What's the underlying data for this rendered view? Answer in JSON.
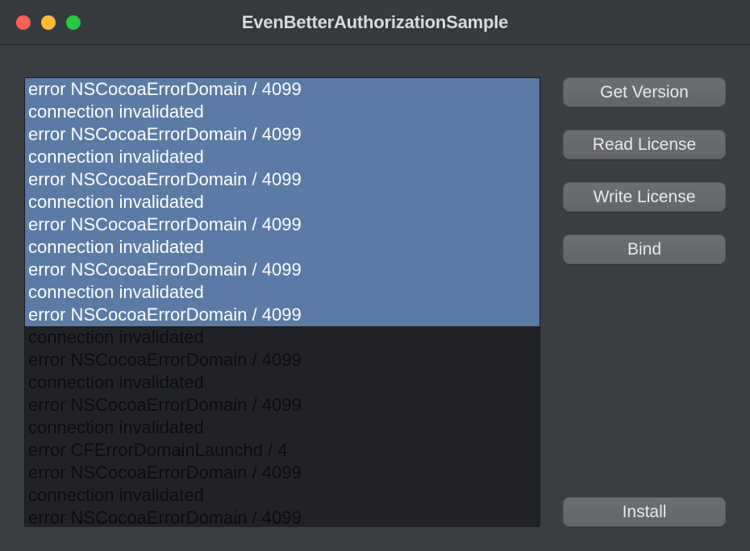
{
  "window": {
    "title": "EvenBetterAuthorizationSample"
  },
  "buttons": {
    "get_version": "Get Version",
    "read_license": "Read License",
    "write_license": "Write License",
    "bind": "Bind",
    "install": "Install"
  },
  "log": {
    "lines": [
      {
        "text": "error NSCocoaErrorDomain / 4099",
        "selected": true
      },
      {
        "text": "connection invalidated",
        "selected": true
      },
      {
        "text": "error NSCocoaErrorDomain / 4099",
        "selected": true
      },
      {
        "text": "connection invalidated",
        "selected": true
      },
      {
        "text": "error NSCocoaErrorDomain / 4099",
        "selected": true
      },
      {
        "text": "connection invalidated",
        "selected": true
      },
      {
        "text": "error NSCocoaErrorDomain / 4099",
        "selected": true
      },
      {
        "text": "connection invalidated",
        "selected": true
      },
      {
        "text": "error NSCocoaErrorDomain / 4099",
        "selected": true
      },
      {
        "text": "connection invalidated",
        "selected": true
      },
      {
        "text": "error NSCocoaErrorDomain / 4099",
        "selected": true
      },
      {
        "text": "connection invalidated",
        "selected": false
      },
      {
        "text": "error NSCocoaErrorDomain / 4099",
        "selected": false
      },
      {
        "text": "connection invalidated",
        "selected": false
      },
      {
        "text": "error NSCocoaErrorDomain / 4099",
        "selected": false
      },
      {
        "text": "connection invalidated",
        "selected": false
      },
      {
        "text": "error CFErrorDomainLaunchd / 4",
        "selected": false
      },
      {
        "text": "error NSCocoaErrorDomain / 4099",
        "selected": false
      },
      {
        "text": "connection invalidated",
        "selected": false
      },
      {
        "text": "error NSCocoaErrorDomain / 4099",
        "selected": false
      }
    ]
  }
}
